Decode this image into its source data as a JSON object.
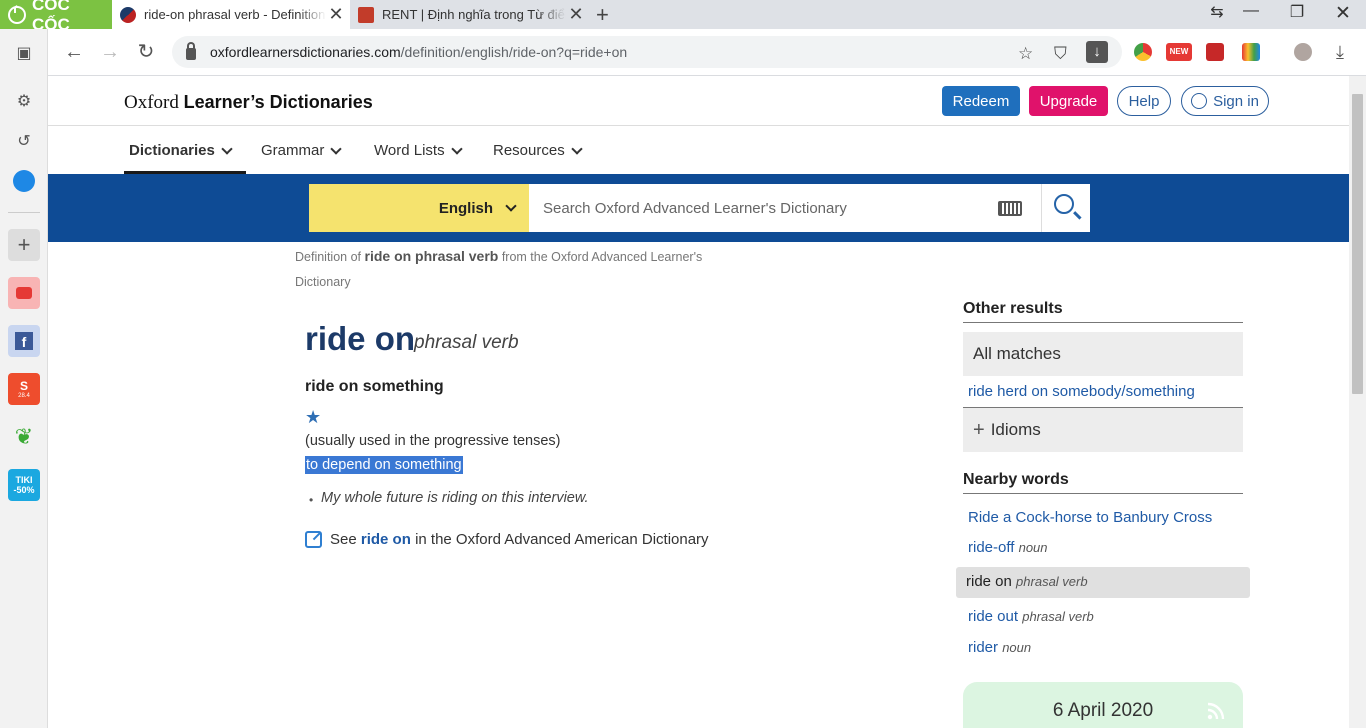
{
  "browser": {
    "brand": "CỐC CỐC",
    "tabs": [
      {
        "title": "ride-on phrasal verb - Definition",
        "active": true
      },
      {
        "title": "RENT | Định nghĩa trong Từ điển",
        "active": false
      }
    ],
    "url_domain": "oxfordlearnersdictionaries.com",
    "url_path": "/definition/english/ride-on?q=ride+on",
    "extension_badge": "NEW"
  },
  "sidebar": {
    "items": [
      "sidebar-toggle",
      "settings",
      "history",
      "messenger",
      "add",
      "youtube",
      "facebook",
      "shopee",
      "grab",
      "tiki"
    ],
    "tiki_label": "TIKI",
    "tiki_badge": "-50%",
    "shopee_badge": "28.4"
  },
  "header": {
    "site_title_prefix": "Oxford",
    "site_title_main": "Learner’s Dictionaries",
    "redeem": "Redeem",
    "upgrade": "Upgrade",
    "help": "Help",
    "sign_in": "Sign in"
  },
  "nav": {
    "items": [
      {
        "label": "Dictionaries"
      },
      {
        "label": "Grammar"
      },
      {
        "label": "Word Lists"
      },
      {
        "label": "Resources"
      }
    ]
  },
  "search": {
    "language": "English",
    "placeholder": "Search Oxford Advanced Learner's Dictionary"
  },
  "entry": {
    "definition_of_prefix": "Definition of",
    "definition_of_word": "ride on phrasal verb",
    "definition_of_suffix": "from the Oxford Advanced Learner's Dictionary",
    "headword": "ride on",
    "pos": "phrasal verb",
    "subentry": "ride on something",
    "grammar_note": "(usually used in the progressive tenses)",
    "definition": "to depend on something",
    "example": "My whole future is riding on this interview.",
    "see_prefix": "See",
    "see_link": "ride on",
    "see_suffix": "in the Oxford Advanced American Dictionary"
  },
  "right_column": {
    "other_results_heading": "Other results",
    "all_matches": "All matches",
    "all_matches_link": "ride herd on somebody/something",
    "idioms": "Idioms",
    "nearby_heading": "Nearby words",
    "nearby": [
      {
        "word": "Ride a Cock-horse to Banbury Cross",
        "pos": ""
      },
      {
        "word": "ride-off",
        "pos": "noun"
      },
      {
        "word": "ride on",
        "pos": "phrasal verb",
        "current": true
      },
      {
        "word": "ride out",
        "pos": "phrasal verb"
      },
      {
        "word": "rider",
        "pos": "noun"
      }
    ],
    "word_of_the_day_date": "6 April 2020"
  },
  "colors": {
    "brand_green": "#7cc242",
    "search_band": "#0e4b95",
    "language_yellow": "#f5e36e",
    "redeem_blue": "#1f6fbd",
    "upgrade_pink": "#e0126b",
    "highlight_blue": "#3a78d4"
  }
}
